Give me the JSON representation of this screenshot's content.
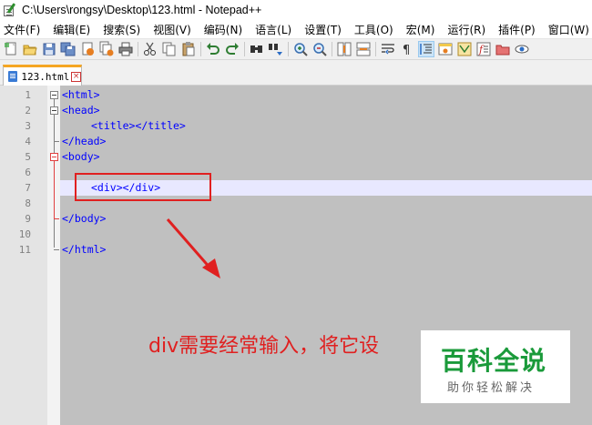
{
  "window": {
    "title": "C:\\Users\\rongsy\\Desktop\\123.html - Notepad++"
  },
  "menu": [
    {
      "label": "文件(F)"
    },
    {
      "label": "编辑(E)"
    },
    {
      "label": "搜索(S)"
    },
    {
      "label": "视图(V)"
    },
    {
      "label": "编码(N)"
    },
    {
      "label": "语言(L)"
    },
    {
      "label": "设置(T)"
    },
    {
      "label": "工具(O)"
    },
    {
      "label": "宏(M)"
    },
    {
      "label": "运行(R)"
    },
    {
      "label": "插件(P)"
    },
    {
      "label": "窗口(W)"
    }
  ],
  "toolbar": {
    "buttons": [
      "new-file-icon",
      "open-file-icon",
      "save-icon",
      "save-all-icon",
      "close-icon",
      "close-all-icon",
      "print-icon",
      "cut-icon",
      "copy-icon",
      "paste-icon",
      "undo-icon",
      "redo-icon",
      "find-icon",
      "replace-icon",
      "zoom-in-icon",
      "zoom-out-icon",
      "sync-vertical-icon",
      "sync-horizontal-icon",
      "word-wrap-icon",
      "show-all-chars-icon",
      "indent-guide-icon",
      "user-lang-icon",
      "doc-map-icon",
      "function-list-icon",
      "folder-workspace-icon",
      "monitoring-icon"
    ]
  },
  "tab": {
    "label": "123.html",
    "close": "×"
  },
  "editor": {
    "lines": [
      {
        "num": "1",
        "text": "<html>"
      },
      {
        "num": "2",
        "text": "<head>"
      },
      {
        "num": "3",
        "text": "<title></title>"
      },
      {
        "num": "4",
        "text": "</head>"
      },
      {
        "num": "5",
        "text": "<body>"
      },
      {
        "num": "6",
        "text": ""
      },
      {
        "num": "7",
        "text": "<div></div>"
      },
      {
        "num": "8",
        "text": ""
      },
      {
        "num": "9",
        "text": "</body>"
      },
      {
        "num": "10",
        "text": ""
      },
      {
        "num": "11",
        "text": "</html>"
      }
    ]
  },
  "annotation": {
    "caption": "div需要经常输入，将它设"
  },
  "watermark": {
    "title": "百科全说",
    "subtitle": "助你轻松解决"
  },
  "colors": {
    "accent_red": "#e02020",
    "tag_blue": "#0000ff",
    "watermark_green": "#1a9a3a",
    "tab_orange": "#f5a623"
  }
}
